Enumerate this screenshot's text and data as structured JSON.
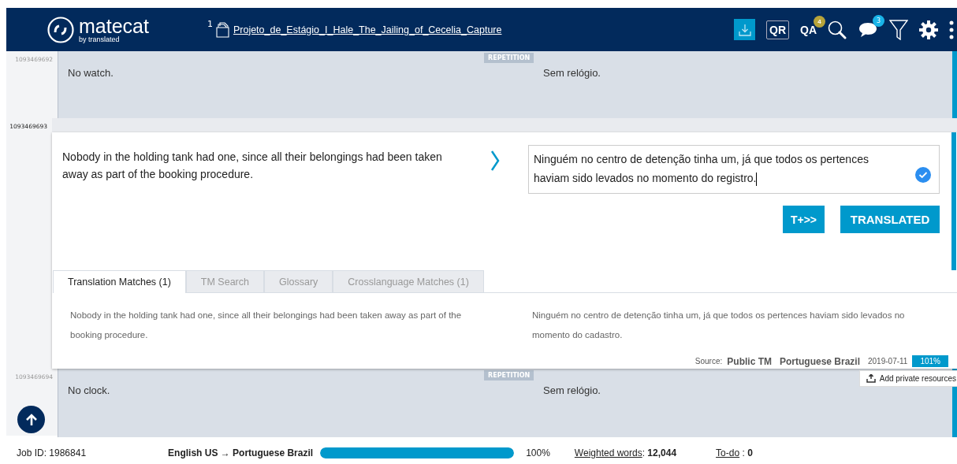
{
  "header": {
    "logo": "matecat",
    "tagline": "by translated",
    "file_count": "1",
    "file_name": "Projeto_de_Estágio_I_Hale_The_Jailing_of_Cecelia_Capture",
    "qr": "QR",
    "qa": "QA",
    "qa_badge": "4",
    "comments_badge": "3"
  },
  "segments": [
    {
      "kind": "repetition",
      "id": "1093469692",
      "badge": "REPETITION",
      "source": "No watch.",
      "target": "Sem relógio."
    },
    {
      "kind": "active",
      "id": "1093469693",
      "source": "Nobody in the holding tank had one, since all their belongings had been taken away as part of the booking procedure.",
      "target": "Ninguém no centro de detenção tinha um, já que todos os pertences haviam sido levados no momento do registro.",
      "buttons": [
        "T+>>",
        "TRANSLATED"
      ],
      "tabs": [
        {
          "label": "Translation Matches (1)",
          "selected": true
        },
        {
          "label": "TM Search",
          "selected": false
        },
        {
          "label": "Glossary",
          "selected": false
        },
        {
          "label": "Crosslanguage Matches (1)",
          "selected": false
        }
      ],
      "match": {
        "source": "Nobody in the holding tank had one, since all their belongings had been taken away as part of the booking procedure.",
        "target": "Ninguém no centro de detenção tinha um, já que todos os pertences haviam sido levados no momento do cadastro.",
        "origin_label": "Source:",
        "origin": "Public TM",
        "language": "Portuguese Brazil",
        "date": "2019-07-11",
        "score": "101%"
      },
      "add_resources": "Add private resources"
    },
    {
      "kind": "repetition",
      "id": "1093469694",
      "badge": "REPETITION",
      "source": "No clock.",
      "target": "Sem relógio."
    }
  ],
  "footer": {
    "job_id": "Job ID: 1986841",
    "source_lang": "English US",
    "arrow": "→",
    "target_lang": "Portuguese Brazil",
    "progress": {
      "level": 1
    },
    "percent": "100%",
    "weighted_label": "Weighted words",
    "weighted_sep": ":",
    "todo_sep": ":",
    "weighted_value": "12,044",
    "todo_label": "To-do",
    "todo_value": "0"
  }
}
